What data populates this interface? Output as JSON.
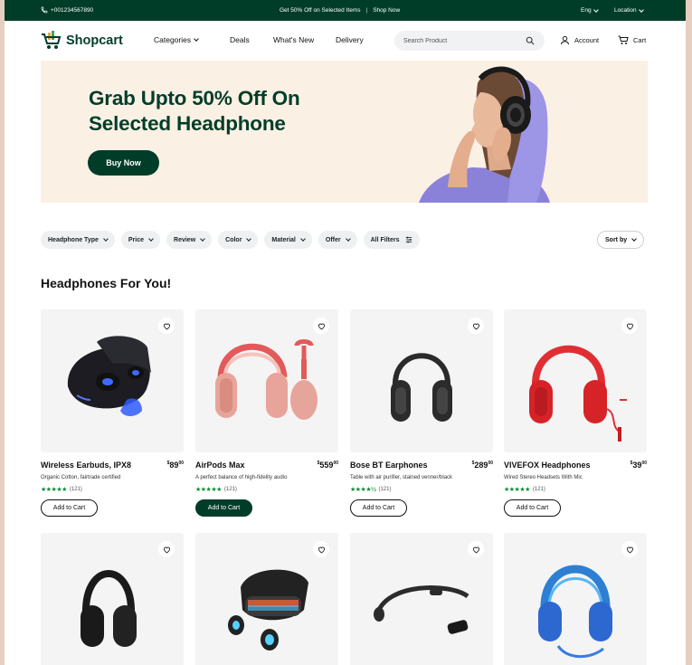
{
  "topbar": {
    "phone": "+001234567890",
    "promo": "Get 50% Off on Selected Items",
    "promo_link": "Shop Now",
    "language": "Eng",
    "location": "Location"
  },
  "nav": {
    "logo": "Shopcart",
    "links": [
      "Categories",
      "Deals",
      "What's New",
      "Delivery"
    ],
    "search_placeholder": "Search Product",
    "account": "Account",
    "cart": "Cart"
  },
  "hero": {
    "headline_1": "Grab Upto 50% Off On",
    "headline_2": "Selected Headphone",
    "button": "Buy Now"
  },
  "filters": [
    "Headphone Type",
    "Price",
    "Review",
    "Color",
    "Material",
    "Offer",
    "All Filters"
  ],
  "sort": "Sort by",
  "section_title": "Headphones For You!",
  "products": [
    {
      "name": "Wireless Earbuds, IPX8",
      "price": "89",
      "cents": "00",
      "desc": "Organic Cotton, fairtrade certified",
      "reviews": "(121)",
      "button": "Add to Cart",
      "icon": "earbuds-icon"
    },
    {
      "name": "AirPods Max",
      "price": "559",
      "cents": "00",
      "desc": "A perfect balance of high-fidelity audio",
      "reviews": "(121)",
      "button": "Add to Cart",
      "icon": "airpods-max-icon"
    },
    {
      "name": "Bose BT Earphones",
      "price": "289",
      "cents": "00",
      "desc": "Table with air purifier, stained venner/black",
      "reviews": "(121)",
      "button": "Add to Cart",
      "icon": "bose-headphones-icon"
    },
    {
      "name": "VIVEFOX Headphones",
      "price": "39",
      "cents": "00",
      "desc": "Wired Stereo Headsets With Mic",
      "reviews": "(121)",
      "button": "Add to Cart",
      "icon": "vivefox-headphones-icon"
    },
    {
      "icon": "black-headphones-icon"
    },
    {
      "icon": "gaming-earbuds-icon"
    },
    {
      "icon": "bone-conduction-icon"
    },
    {
      "icon": "kids-headphones-icon"
    }
  ],
  "colors": {
    "brand": "#003d29",
    "star": "#0a8a32",
    "hero_bg": "#fbf0e4"
  }
}
